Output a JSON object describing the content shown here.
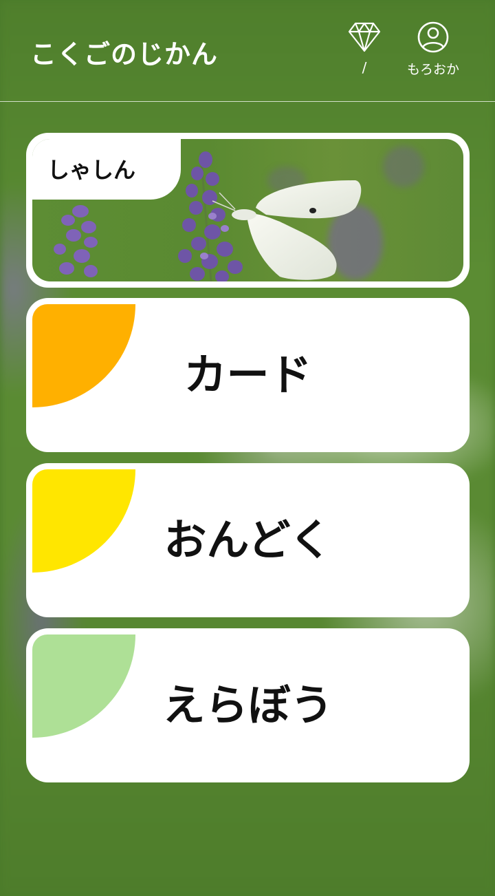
{
  "header": {
    "title": "こくごのじかん",
    "diamond_icon": "diamond-icon",
    "diamond_count": "/",
    "user_icon": "user-circle-icon",
    "user_name": "もろおか"
  },
  "menu": {
    "photo": {
      "label": "しゃしん"
    },
    "items": [
      {
        "label": "カード",
        "accent": "#ffb000"
      },
      {
        "label": "おんどく",
        "accent": "#ffe600"
      },
      {
        "label": "えらぼう",
        "accent": "#aee096"
      }
    ]
  },
  "colors": {
    "background": "#5a8a33",
    "card": "#ffffff",
    "text": "#111111"
  }
}
